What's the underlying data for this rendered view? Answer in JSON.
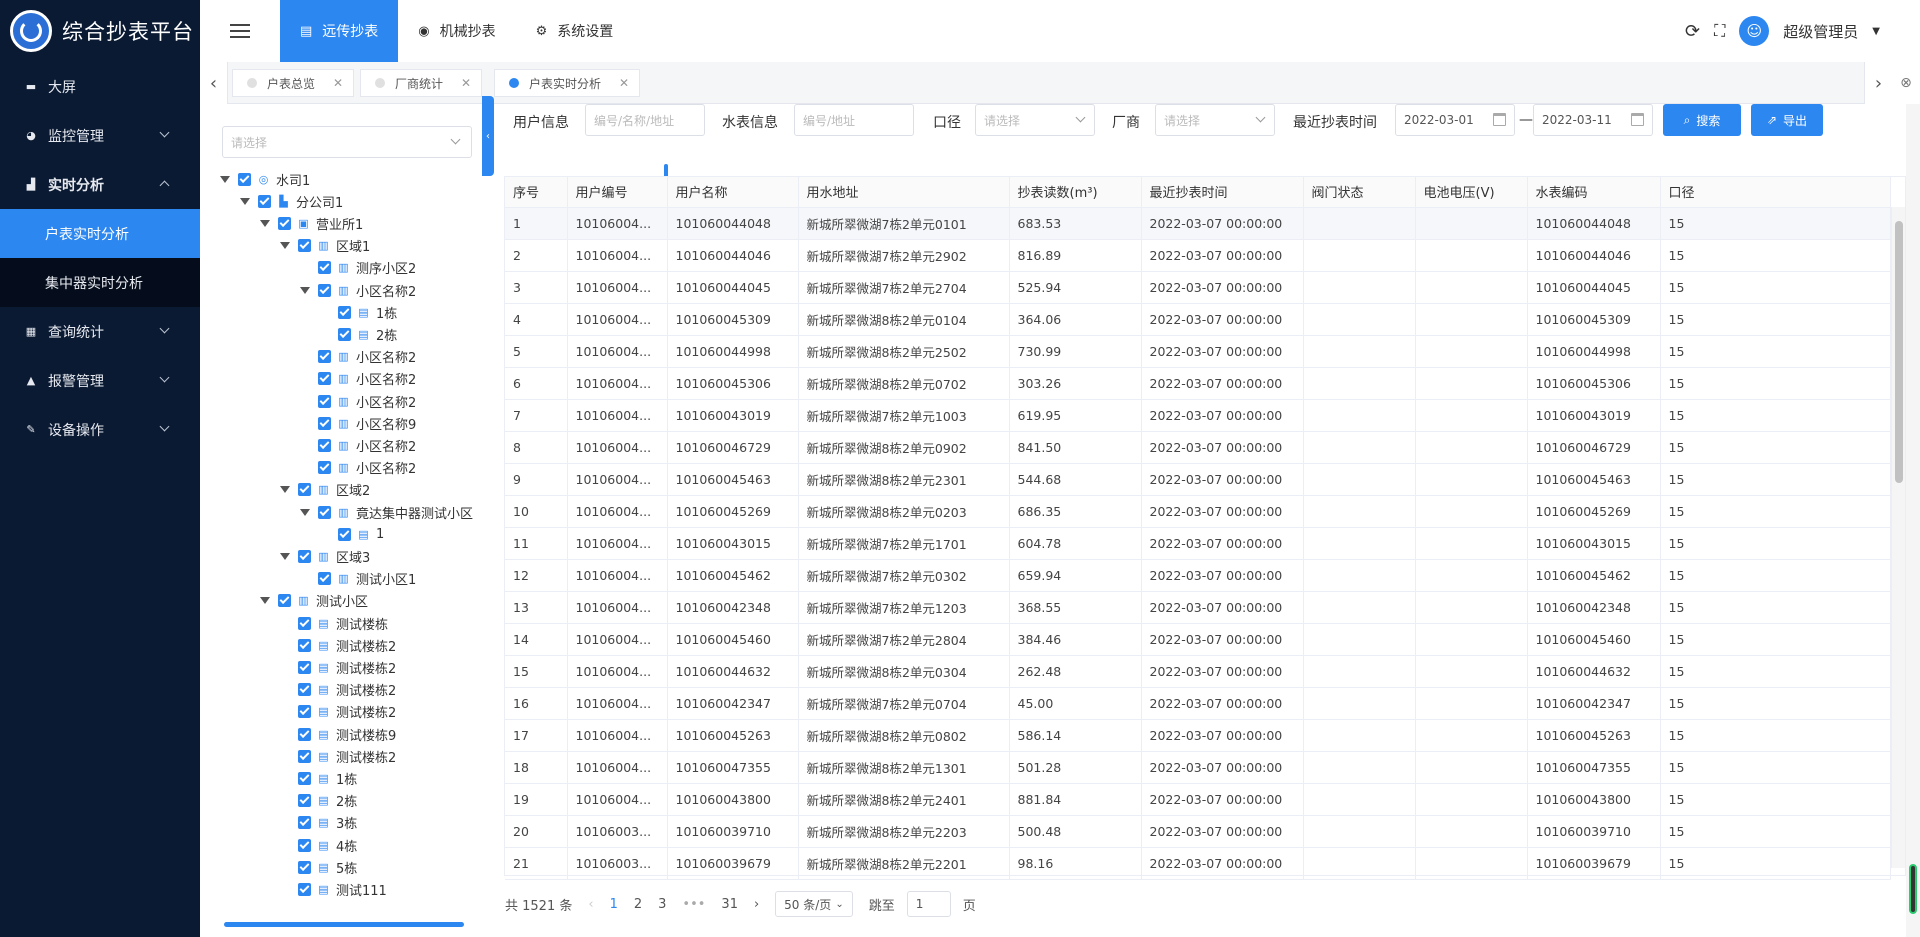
{
  "app": {
    "title": "综合抄表平台"
  },
  "sidebar": {
    "items": [
      {
        "label": "大屏",
        "icon": "monitor-icon"
      },
      {
        "label": "监控管理",
        "icon": "pie-icon"
      },
      {
        "label": "实时分析",
        "icon": "bar-icon",
        "expanded": true,
        "children": [
          {
            "label": "户表实时分析",
            "active": true
          },
          {
            "label": "集中器实时分析"
          }
        ]
      },
      {
        "label": "查询统计",
        "icon": "calendar-icon"
      },
      {
        "label": "报警管理",
        "icon": "alarm-icon"
      },
      {
        "label": "设备操作",
        "icon": "wrench-icon"
      }
    ]
  },
  "header": {
    "tabs": [
      {
        "label": "远传抄表",
        "icon": "list-icon",
        "active": true
      },
      {
        "label": "机械抄表",
        "icon": "gauge-icon"
      },
      {
        "label": "系统设置",
        "icon": "gear-icon"
      }
    ],
    "user": "超级管理员"
  },
  "page_tabs": [
    {
      "label": "户表总览"
    },
    {
      "label": "厂商统计"
    },
    {
      "label": "户表实时分析",
      "active": true
    }
  ],
  "tree": {
    "placeholder": "请选择",
    "nodes": [
      {
        "label": "水司1",
        "level": 0,
        "icon": "company-icon",
        "open": true
      },
      {
        "label": "分公司1",
        "level": 1,
        "icon": "building-icon",
        "open": true
      },
      {
        "label": "营业所1",
        "level": 2,
        "icon": "office-icon",
        "open": true
      },
      {
        "label": "区域1",
        "level": 3,
        "icon": "map-icon",
        "open": true
      },
      {
        "label": "测序小区2",
        "level": 4,
        "icon": "community-icon"
      },
      {
        "label": "小区名称2",
        "level": 4,
        "icon": "community-icon",
        "open": true
      },
      {
        "label": "1栋",
        "level": 5,
        "icon": "floor-icon"
      },
      {
        "label": "2栋",
        "level": 5,
        "icon": "floor-icon"
      },
      {
        "label": "小区名称2",
        "level": 4,
        "icon": "community-icon"
      },
      {
        "label": "小区名称2",
        "level": 4,
        "icon": "community-icon"
      },
      {
        "label": "小区名称2",
        "level": 4,
        "icon": "community-icon"
      },
      {
        "label": "小区名称9",
        "level": 4,
        "icon": "community-icon"
      },
      {
        "label": "小区名称2",
        "level": 4,
        "icon": "community-icon"
      },
      {
        "label": "小区名称2",
        "level": 4,
        "icon": "community-icon"
      },
      {
        "label": "区域2",
        "level": 3,
        "icon": "map-icon",
        "open": true
      },
      {
        "label": "竟达集中器测试小区",
        "level": 4,
        "icon": "community-icon",
        "open": true
      },
      {
        "label": "1",
        "level": 5,
        "icon": "floor-icon"
      },
      {
        "label": "区域3",
        "level": 3,
        "icon": "map-icon",
        "open": true
      },
      {
        "label": "测试小区1",
        "level": 4,
        "icon": "community-icon"
      },
      {
        "label": "测试小区",
        "level": 2,
        "icon": "community-icon",
        "open": true
      },
      {
        "label": "测试楼栋",
        "level": 3,
        "icon": "floor-icon"
      },
      {
        "label": "测试楼栋2",
        "level": 3,
        "icon": "floor-icon"
      },
      {
        "label": "测试楼栋2",
        "level": 3,
        "icon": "floor-icon"
      },
      {
        "label": "测试楼栋2",
        "level": 3,
        "icon": "floor-icon"
      },
      {
        "label": "测试楼栋2",
        "level": 3,
        "icon": "floor-icon"
      },
      {
        "label": "测试楼栋9",
        "level": 3,
        "icon": "floor-icon"
      },
      {
        "label": "测试楼栋2",
        "level": 3,
        "icon": "floor-icon"
      },
      {
        "label": "1栋",
        "level": 3,
        "icon": "floor-icon"
      },
      {
        "label": "2栋",
        "level": 3,
        "icon": "floor-icon"
      },
      {
        "label": "3栋",
        "level": 3,
        "icon": "floor-icon"
      },
      {
        "label": "4栋",
        "level": 3,
        "icon": "floor-icon"
      },
      {
        "label": "5栋",
        "level": 3,
        "icon": "floor-icon"
      },
      {
        "label": "测试111",
        "level": 3,
        "icon": "floor-icon"
      }
    ]
  },
  "filters": {
    "user_label": "用户信息",
    "user_placeholder": "编号/名称/地址",
    "meter_label": "水表信息",
    "meter_placeholder": "编号/地址",
    "caliber_label": "口径",
    "caliber_placeholder": "请选择",
    "vendor_label": "厂商",
    "vendor_placeholder": "请选择",
    "time_label": "最近抄表时间",
    "date_from": "2022-03-01",
    "date_to": "2022-03-11",
    "date_sep": "—",
    "search_label": "搜索",
    "export_label": "导出"
  },
  "table": {
    "columns": [
      "序号",
      "用户编号",
      "用户名称",
      "用水地址",
      "抄表读数(m³)",
      "最近抄表时间",
      "阀门状态",
      "电池电压(V)",
      "水表编码",
      "口径"
    ],
    "rows": [
      [
        "1",
        "10106004...",
        "101060044048",
        "新城所翠微湖7栋2单元0101",
        "683.53",
        "2022-03-07 00:00:00",
        "",
        "",
        "101060044048",
        "15"
      ],
      [
        "2",
        "10106004...",
        "101060044046",
        "新城所翠微湖7栋2单元2902",
        "816.89",
        "2022-03-07 00:00:00",
        "",
        "",
        "101060044046",
        "15"
      ],
      [
        "3",
        "10106004...",
        "101060044045",
        "新城所翠微湖7栋2单元2704",
        "525.94",
        "2022-03-07 00:00:00",
        "",
        "",
        "101060044045",
        "15"
      ],
      [
        "4",
        "10106004...",
        "101060045309",
        "新城所翠微湖8栋2单元0104",
        "364.06",
        "2022-03-07 00:00:00",
        "",
        "",
        "101060045309",
        "15"
      ],
      [
        "5",
        "10106004...",
        "101060044998",
        "新城所翠微湖8栋2单元2502",
        "730.99",
        "2022-03-07 00:00:00",
        "",
        "",
        "101060044998",
        "15"
      ],
      [
        "6",
        "10106004...",
        "101060045306",
        "新城所翠微湖8栋2单元0702",
        "303.26",
        "2022-03-07 00:00:00",
        "",
        "",
        "101060045306",
        "15"
      ],
      [
        "7",
        "10106004...",
        "101060043019",
        "新城所翠微湖7栋2单元1003",
        "619.95",
        "2022-03-07 00:00:00",
        "",
        "",
        "101060043019",
        "15"
      ],
      [
        "8",
        "10106004...",
        "101060046729",
        "新城所翠微湖8栋2单元0902",
        "841.50",
        "2022-03-07 00:00:00",
        "",
        "",
        "101060046729",
        "15"
      ],
      [
        "9",
        "10106004...",
        "101060045463",
        "新城所翠微湖8栋2单元2301",
        "544.68",
        "2022-03-07 00:00:00",
        "",
        "",
        "101060045463",
        "15"
      ],
      [
        "10",
        "10106004...",
        "101060045269",
        "新城所翠微湖8栋2单元0203",
        "686.35",
        "2022-03-07 00:00:00",
        "",
        "",
        "101060045269",
        "15"
      ],
      [
        "11",
        "10106004...",
        "101060043015",
        "新城所翠微湖7栋2单元1701",
        "604.78",
        "2022-03-07 00:00:00",
        "",
        "",
        "101060043015",
        "15"
      ],
      [
        "12",
        "10106004...",
        "101060045462",
        "新城所翠微湖7栋2单元0302",
        "659.94",
        "2022-03-07 00:00:00",
        "",
        "",
        "101060045462",
        "15"
      ],
      [
        "13",
        "10106004...",
        "101060042348",
        "新城所翠微湖7栋2单元1203",
        "368.55",
        "2022-03-07 00:00:00",
        "",
        "",
        "101060042348",
        "15"
      ],
      [
        "14",
        "10106004...",
        "101060045460",
        "新城所翠微湖7栋2单元2804",
        "384.46",
        "2022-03-07 00:00:00",
        "",
        "",
        "101060045460",
        "15"
      ],
      [
        "15",
        "10106004...",
        "101060044632",
        "新城所翠微湖8栋2单元0304",
        "262.48",
        "2022-03-07 00:00:00",
        "",
        "",
        "101060044632",
        "15"
      ],
      [
        "16",
        "10106004...",
        "101060042347",
        "新城所翠微湖7栋2单元0704",
        "45.00",
        "2022-03-07 00:00:00",
        "",
        "",
        "101060042347",
        "15"
      ],
      [
        "17",
        "10106004...",
        "101060045263",
        "新城所翠微湖8栋2单元0802",
        "586.14",
        "2022-03-07 00:00:00",
        "",
        "",
        "101060045263",
        "15"
      ],
      [
        "18",
        "10106004...",
        "101060047355",
        "新城所翠微湖8栋2单元1301",
        "501.28",
        "2022-03-07 00:00:00",
        "",
        "",
        "101060047355",
        "15"
      ],
      [
        "19",
        "10106004...",
        "101060043800",
        "新城所翠微湖8栋2单元2401",
        "881.84",
        "2022-03-07 00:00:00",
        "",
        "",
        "101060043800",
        "15"
      ],
      [
        "20",
        "10106003...",
        "101060039710",
        "新城所翠微湖8栋2单元2203",
        "500.48",
        "2022-03-07 00:00:00",
        "",
        "",
        "101060039710",
        "15"
      ],
      [
        "21",
        "10106003...",
        "101060039679",
        "新城所翠微湖8栋2单元2201",
        "98.16",
        "2022-03-07 00:00:00",
        "",
        "",
        "101060039679",
        "15"
      ]
    ]
  },
  "pager": {
    "total": "共 1521 条",
    "pages": [
      "1",
      "2",
      "3",
      "•••",
      "31"
    ],
    "current": "1",
    "page_size": "50 条/页",
    "jump_label": "跳至",
    "jump_value": "1",
    "page_unit": "页"
  },
  "colors": {
    "primary": "#2d87f0",
    "sidebar": "#0b1a33"
  }
}
